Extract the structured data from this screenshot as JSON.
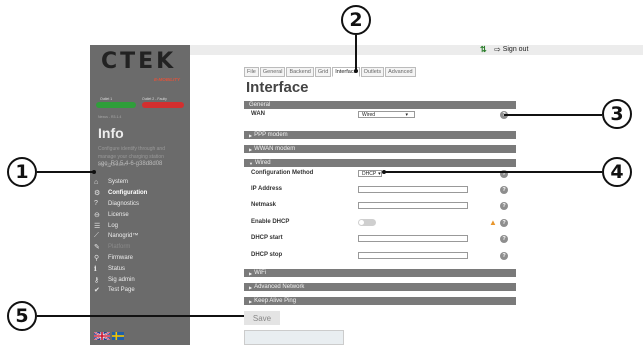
{
  "callouts": [
    "1",
    "2",
    "3",
    "4",
    "5"
  ],
  "sidebar": {
    "logo": "CTEK",
    "tagline": "E-MOBILITY",
    "status_labels": [
      "Outlet 1",
      "Outlet 2 - Faulty"
    ],
    "status_colors": [
      "#2f9e3a",
      "#d32f2f"
    ],
    "version": "Nexus - R3.1.4",
    "title": "Info",
    "description": "Configure identify through and manage your charging station configuration",
    "serial": "sgc_R3.5.4-6-g38d8d08",
    "menu": [
      {
        "icon": "home-icon",
        "glyph": "⌂",
        "label": "System"
      },
      {
        "icon": "gear-icon",
        "glyph": "⚙",
        "label": "Configuration"
      },
      {
        "icon": "question-icon",
        "glyph": "?",
        "label": "Diagnostics"
      },
      {
        "icon": "lock-icon",
        "glyph": "🔒",
        "label": "License"
      },
      {
        "icon": "list-icon",
        "glyph": "☰",
        "label": "Log"
      },
      {
        "icon": "chart-icon",
        "glyph": "⟋",
        "label": "Nanogrid™"
      },
      {
        "icon": "wrench-icon",
        "glyph": "✎",
        "label": "Platform"
      },
      {
        "icon": "firmware-icon",
        "glyph": "⚲",
        "label": "Firmware"
      },
      {
        "icon": "info-icon",
        "glyph": "i",
        "label": "Status"
      },
      {
        "icon": "key-icon",
        "glyph": "⚷",
        "label": "Sig admin"
      },
      {
        "icon": "check-icon",
        "glyph": "✔",
        "label": "Test Page"
      }
    ],
    "flags": "🇬🇧 ➕"
  },
  "topbar": {
    "sync_glyph": "⇅",
    "signout_glyph": "⇨",
    "signout_label": "Sign out"
  },
  "tabs": [
    "File",
    "General",
    "Backend",
    "Grid",
    "Interface",
    "Outlets",
    "Advanced"
  ],
  "page": {
    "title": "Interface",
    "sections": {
      "general": "General",
      "ppp": "PPP modem",
      "wwan": "WWAN modem",
      "wired": "Wired",
      "wifi": "WiFi",
      "advnet": "Advanced Network",
      "keepalive": "Keep Alive Ping"
    },
    "wan_label": "WAN",
    "wan_value": "Wired",
    "select_arrow": "▾",
    "collapsed_arrow": "▶",
    "expanded_arrow": "▼",
    "help_glyph": "?",
    "warn_glyph": "▲",
    "fields": {
      "config_method_label": "Configuration Method",
      "config_method_value": "DHCP",
      "ip_label": "IP Address",
      "netmask_label": "Netmask",
      "enable_dhcp_label": "Enable DHCP",
      "dhcp_start_label": "DHCP start",
      "dhcp_stop_label": "DHCP stop"
    },
    "save_label": "Save"
  }
}
